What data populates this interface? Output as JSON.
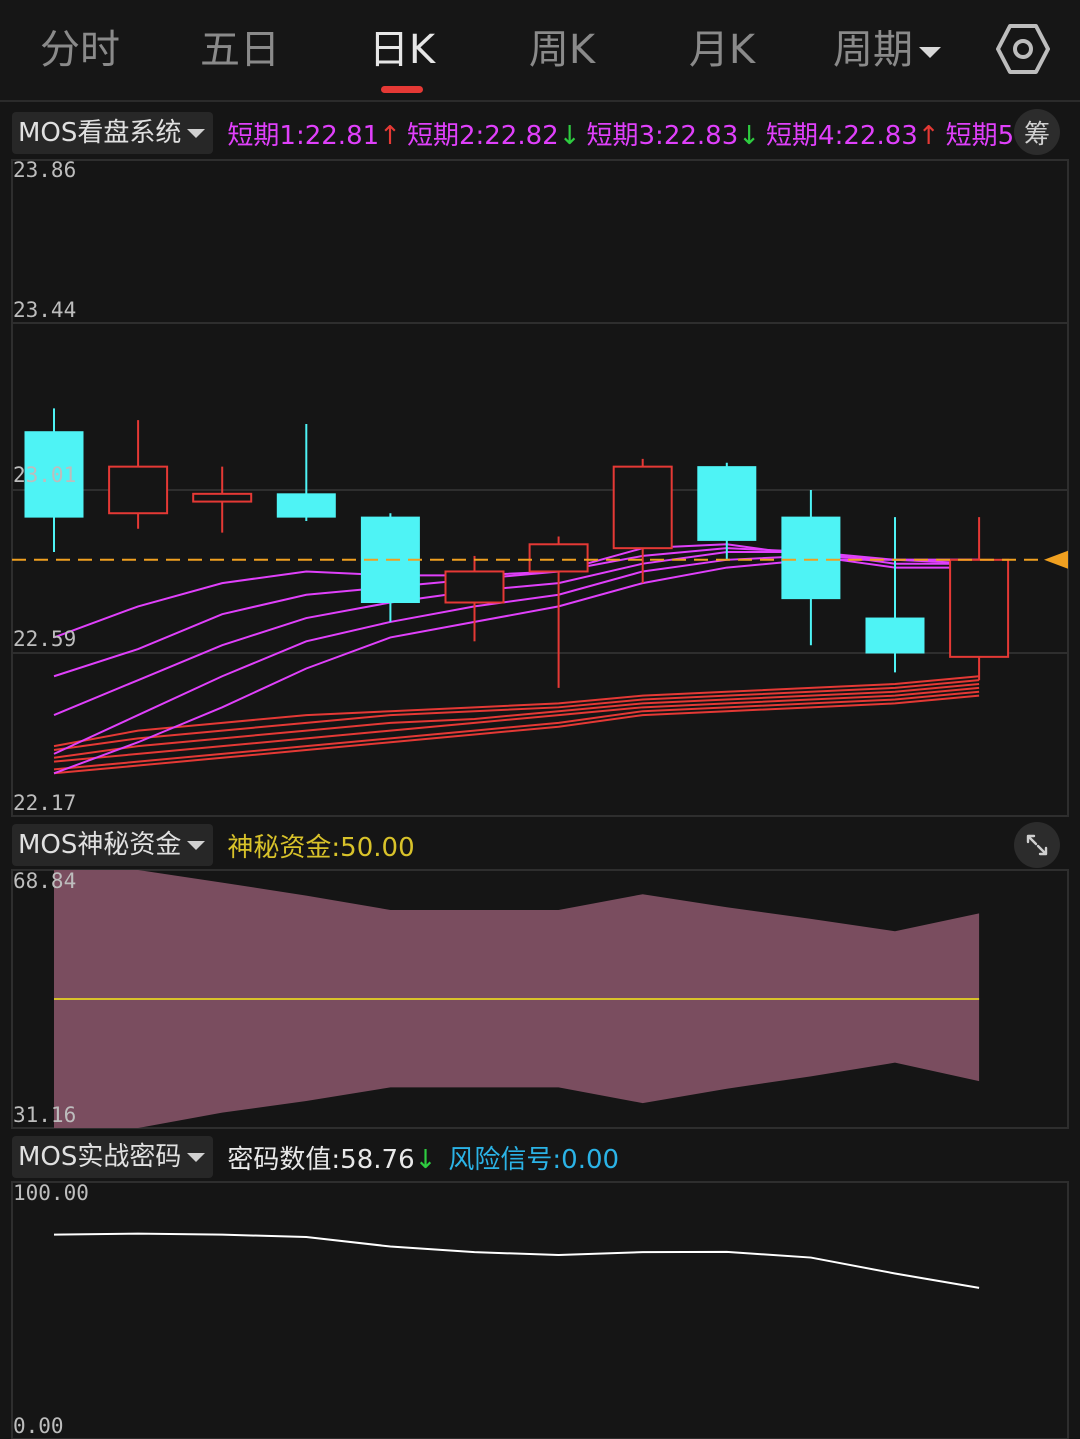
{
  "tabs": [
    {
      "label": "分时",
      "active": false
    },
    {
      "label": "五日",
      "active": false
    },
    {
      "label": "日K",
      "active": true
    },
    {
      "label": "周K",
      "active": false
    },
    {
      "label": "月K",
      "active": false
    },
    {
      "label": "周期",
      "active": false,
      "dropdown": true
    }
  ],
  "colors": {
    "up": "#e53935",
    "down": "#4ef3f5",
    "ma_pink": "#e040fb",
    "ma_red": "#e53935",
    "price_line": "#f0a020",
    "fund_band": "#7a4d5f",
    "fund_line": "#d8c22a",
    "code_line": "#ffffff",
    "cyan_text": "#2bb3e6"
  },
  "panel1": {
    "selector": "MOS看盘系统",
    "values": [
      {
        "label": "短期1:",
        "value": "22.81",
        "arrow": "↑"
      },
      {
        "label": "短期2:",
        "value": "22.82",
        "arrow": "↓"
      },
      {
        "label": "短期3:",
        "value": "22.83",
        "arrow": "↓"
      },
      {
        "label": "短期4:",
        "value": "22.83",
        "arrow": "↑"
      },
      {
        "label": "短期5",
        "value": "",
        "arrow": ""
      }
    ],
    "chip_button": "筹",
    "y_labels": [
      "23.86",
      "23.44",
      "23.01",
      "22.59",
      "22.17"
    ]
  },
  "panel2": {
    "selector": "MOS神秘资金",
    "values": [
      {
        "label": "神秘资金:",
        "value": "50.00"
      }
    ],
    "y_labels": [
      "68.84",
      "31.16"
    ]
  },
  "panel3": {
    "selector": "MOS实战密码",
    "values": [
      {
        "label": "密码数值:",
        "value": "58.76",
        "arrow": "↓"
      },
      {
        "label": "风险信号:",
        "value": "0.00"
      }
    ],
    "y_labels": [
      "100.00",
      "0.00"
    ]
  },
  "chart_data": [
    {
      "type": "candlestick",
      "ylim": [
        22.17,
        23.86
      ],
      "current_price": 22.83,
      "candles": [
        {
          "open": 23.16,
          "close": 22.94,
          "high": 23.22,
          "low": 22.85
        },
        {
          "open": 22.95,
          "close": 23.07,
          "high": 23.19,
          "low": 22.91
        },
        {
          "open": 22.98,
          "close": 23.0,
          "high": 23.07,
          "low": 22.9
        },
        {
          "open": 23.0,
          "close": 22.94,
          "high": 23.18,
          "low": 22.93
        },
        {
          "open": 22.94,
          "close": 22.72,
          "high": 22.95,
          "low": 22.67
        },
        {
          "open": 22.72,
          "close": 22.8,
          "high": 22.84,
          "low": 22.62
        },
        {
          "open": 22.8,
          "close": 22.87,
          "high": 22.89,
          "low": 22.5
        },
        {
          "open": 22.86,
          "close": 23.07,
          "high": 23.09,
          "low": 22.77
        },
        {
          "open": 23.07,
          "close": 22.88,
          "high": 23.08,
          "low": 22.83
        },
        {
          "open": 22.94,
          "close": 22.73,
          "high": 23.01,
          "low": 22.61
        },
        {
          "open": 22.68,
          "close": 22.59,
          "high": 22.94,
          "low": 22.54
        },
        {
          "open": 22.58,
          "close": 22.83,
          "high": 22.94,
          "low": 22.52
        }
      ],
      "ma_pink": [
        [
          22.63,
          22.71,
          22.77,
          22.8,
          22.79,
          22.79,
          22.8,
          22.86,
          22.87,
          22.84,
          22.81,
          22.81
        ],
        [
          22.53,
          22.6,
          22.69,
          22.74,
          22.76,
          22.78,
          22.8,
          22.84,
          22.86,
          22.85,
          22.82,
          22.82
        ],
        [
          22.43,
          22.52,
          22.61,
          22.68,
          22.72,
          22.75,
          22.77,
          22.82,
          22.85,
          22.85,
          22.83,
          22.83
        ],
        [
          22.33,
          22.43,
          22.53,
          22.62,
          22.67,
          22.71,
          22.74,
          22.8,
          22.83,
          22.84,
          22.83,
          22.83
        ],
        [
          22.28,
          22.36,
          22.45,
          22.55,
          22.63,
          22.67,
          22.71,
          22.77,
          22.81,
          22.83,
          22.83,
          22.82
        ]
      ],
      "ma_red": [
        [
          22.35,
          22.39,
          22.41,
          22.43,
          22.44,
          22.45,
          22.46,
          22.48,
          22.49,
          22.5,
          22.51,
          22.53
        ],
        [
          22.34,
          22.37,
          22.39,
          22.41,
          22.43,
          22.44,
          22.45,
          22.47,
          22.48,
          22.49,
          22.5,
          22.52
        ],
        [
          22.32,
          22.35,
          22.37,
          22.39,
          22.41,
          22.42,
          22.44,
          22.46,
          22.47,
          22.48,
          22.49,
          22.51
        ],
        [
          22.31,
          22.33,
          22.35,
          22.37,
          22.39,
          22.41,
          22.43,
          22.45,
          22.46,
          22.47,
          22.48,
          22.5
        ],
        [
          22.29,
          22.31,
          22.33,
          22.35,
          22.37,
          22.39,
          22.41,
          22.44,
          22.45,
          22.46,
          22.47,
          22.49
        ],
        [
          22.28,
          22.3,
          22.32,
          22.34,
          22.36,
          22.38,
          22.4,
          22.43,
          22.44,
          22.45,
          22.46,
          22.48
        ]
      ]
    },
    {
      "type": "area",
      "ylim": [
        31.16,
        68.84
      ],
      "upper": [
        68.84,
        68.84,
        67.0,
        65.1,
        63.0,
        63.0,
        63.0,
        65.3,
        63.4,
        61.7,
        59.9,
        62.5
      ],
      "lower": [
        31.16,
        31.16,
        33.4,
        35.1,
        37.1,
        37.1,
        37.1,
        34.8,
        36.9,
        38.7,
        40.7,
        38.0
      ],
      "mid": 50.0
    },
    {
      "type": "line",
      "ylim": [
        0,
        100
      ],
      "values": [
        79.5,
        79.9,
        79.5,
        78.6,
        74.9,
        72.7,
        71.6,
        72.7,
        72.8,
        70.6,
        64.4,
        58.8
      ]
    }
  ]
}
